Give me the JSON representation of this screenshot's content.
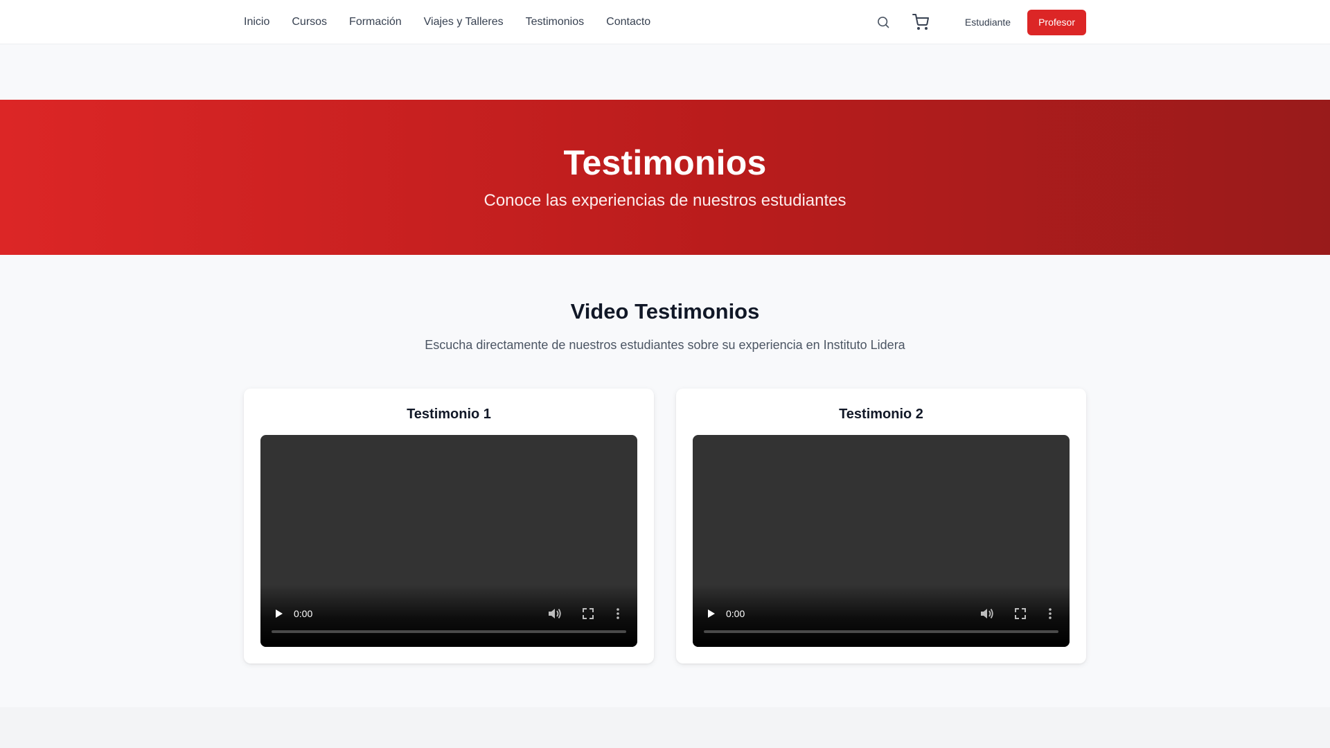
{
  "nav": {
    "links": [
      "Inicio",
      "Cursos",
      "Formación",
      "Viajes y Talleres",
      "Testimonios",
      "Contacto"
    ],
    "search_icon": "search-icon",
    "cart_icon": "cart-icon",
    "student_label": "Estudiante",
    "teacher_label": "Profesor"
  },
  "hero": {
    "title": "Testimonios",
    "subtitle": "Conoce las experiencias de nuestros estudiantes"
  },
  "section": {
    "title": "Video Testimonios",
    "subtitle": "Escucha directamente de nuestros estudiantes sobre su experiencia en Instituto Lidera"
  },
  "testimonials": [
    {
      "title": "Testimonio 1",
      "time": "0:00"
    },
    {
      "title": "Testimonio 2",
      "time": "0:00"
    }
  ],
  "colors": {
    "brand_red": "#dc2626",
    "hero_gradient_start": "#dc2626",
    "hero_gradient_end": "#991b1b",
    "page_background": "#f8f9fb"
  }
}
